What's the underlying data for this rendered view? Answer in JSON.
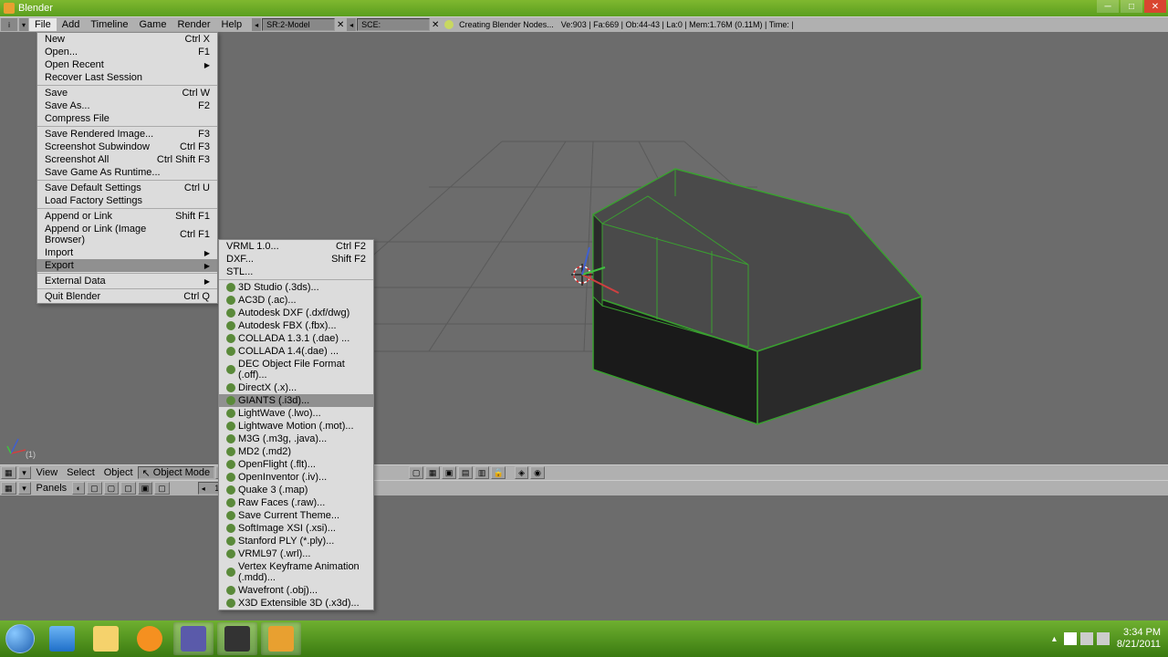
{
  "window": {
    "title": "Blender"
  },
  "menubar": {
    "items": [
      "File",
      "Add",
      "Timeline",
      "Game",
      "Render",
      "Help"
    ],
    "sr_field": "SR:2-Model",
    "sce_field": "SCE:",
    "status_title": "Creating Blender Nodes...",
    "status": "Ve:903 | Fa:669 | Ob:44-43 | La:0 | Mem:1.76M (0.11M) | Time: |"
  },
  "file_menu": [
    {
      "label": "New",
      "shortcut": "Ctrl X"
    },
    {
      "label": "Open...",
      "shortcut": "F1"
    },
    {
      "label": "Open Recent",
      "submenu": true
    },
    {
      "label": "Recover Last Session"
    },
    {
      "sep": true
    },
    {
      "label": "Save",
      "shortcut": "Ctrl W"
    },
    {
      "label": "Save As...",
      "shortcut": "F2"
    },
    {
      "label": "Compress File"
    },
    {
      "sep": true
    },
    {
      "label": "Save Rendered Image...",
      "shortcut": "F3"
    },
    {
      "label": "Screenshot Subwindow",
      "shortcut": "Ctrl F3"
    },
    {
      "label": "Screenshot All",
      "shortcut": "Ctrl Shift F3"
    },
    {
      "label": "Save Game As Runtime..."
    },
    {
      "sep": true
    },
    {
      "label": "Save Default Settings",
      "shortcut": "Ctrl U"
    },
    {
      "label": "Load Factory Settings"
    },
    {
      "sep": true
    },
    {
      "label": "Append or Link",
      "shortcut": "Shift F1"
    },
    {
      "label": "Append or Link (Image Browser)",
      "shortcut": "Ctrl F1"
    },
    {
      "label": "Import",
      "submenu": true
    },
    {
      "label": "Export",
      "submenu": true,
      "highlighted": true
    },
    {
      "sep": true
    },
    {
      "label": "External Data",
      "submenu": true
    },
    {
      "sep": true
    },
    {
      "label": "Quit Blender",
      "shortcut": "Ctrl Q"
    }
  ],
  "export_menu": [
    {
      "label": "VRML 1.0...",
      "shortcut": "Ctrl F2"
    },
    {
      "label": "DXF...",
      "shortcut": "Shift F2"
    },
    {
      "label": "STL..."
    },
    {
      "sep": true
    },
    {
      "label": "3D Studio (.3ds)...",
      "icon": true
    },
    {
      "label": "AC3D (.ac)...",
      "icon": true
    },
    {
      "label": "Autodesk DXF (.dxf/dwg)",
      "icon": true
    },
    {
      "label": "Autodesk FBX (.fbx)...",
      "icon": true
    },
    {
      "label": "COLLADA 1.3.1 (.dae) ...",
      "icon": true
    },
    {
      "label": "COLLADA 1.4(.dae) ...",
      "icon": true
    },
    {
      "label": "DEC Object File Format (.off)...",
      "icon": true
    },
    {
      "label": "DirectX (.x)...",
      "icon": true
    },
    {
      "label": "GIANTS (.i3d)...",
      "icon": true,
      "highlighted": true
    },
    {
      "label": "LightWave (.lwo)...",
      "icon": true
    },
    {
      "label": "Lightwave Motion (.mot)...",
      "icon": true
    },
    {
      "label": "M3G (.m3g, .java)...",
      "icon": true
    },
    {
      "label": "MD2 (.md2)",
      "icon": true
    },
    {
      "label": "OpenFlight (.flt)...",
      "icon": true
    },
    {
      "label": "OpenInventor (.iv)...",
      "icon": true
    },
    {
      "label": "Quake 3 (.map)",
      "icon": true
    },
    {
      "label": "Raw Faces (.raw)...",
      "icon": true
    },
    {
      "label": "Save Current Theme...",
      "icon": true
    },
    {
      "label": "SoftImage XSI (.xsi)...",
      "icon": true
    },
    {
      "label": "Stanford PLY (*.ply)...",
      "icon": true
    },
    {
      "label": "VRML97 (.wrl)...",
      "icon": true
    },
    {
      "label": "Vertex Keyframe Animation (.mdd)...",
      "icon": true
    },
    {
      "label": "Wavefront (.obj)...",
      "icon": true
    },
    {
      "label": "X3D Extensible 3D (.x3d)...",
      "icon": true
    }
  ],
  "toolbar3d": {
    "view": "View",
    "select": "Select",
    "object": "Object",
    "mode": "Object Mode"
  },
  "panels": {
    "label": "Panels",
    "spinner": "1"
  },
  "axis_label": "(1)",
  "tray": {
    "time": "3:34 PM",
    "date": "8/21/2011"
  }
}
